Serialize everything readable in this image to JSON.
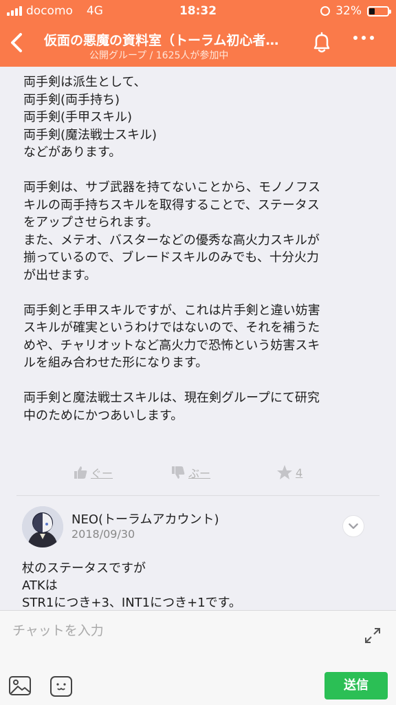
{
  "status_bar": {
    "carrier": "docomo",
    "network": "4G",
    "time": "18:32",
    "battery": "32%",
    "battery_level": 0.32
  },
  "header": {
    "title": "仮面の悪魔の資料室（トーラム初心者…",
    "subtitle": "公開グループ / 1625人が参加中",
    "background_color": "#fa7a4a"
  },
  "post": {
    "body": "両手剣は派生として、\n両手剣(両手持ち)\n両手剣(手甲スキル)\n両手剣(魔法戦士スキル)\nなどがあります。\n\n両手剣は、サブ武器を持てないことから、モノノフス\nキルの両手持ちスキルを取得することで、ステータス\nをアップさせられます。\nまた、メテオ、バスターなどの優秀な高火力スキルが\n揃っているので、ブレードスキルのみでも、十分火力\nが出せます。\n\n両手剣と手甲スキルですが、これは片手剣と違い妨害\nスキルが確実というわけではないので、それを補うた\nめや、チャリオットなど高火力で恐怖という妨害スキ\nルを組み合わせた形になります。\n\n両手剣と魔法戦士スキルは、現在剣グループにて研究\n中のためにかつあいします。",
    "actions": {
      "good_label": "ぐー",
      "bad_label": "ぶー",
      "star_count": "4"
    }
  },
  "comment": {
    "author": "NEO(トーラムアカウント)",
    "date": "2018/09/30",
    "body": "杖のステータスですが\nATKは\nSTR1につき+3、INT1につき+1です。"
  },
  "input_bar": {
    "placeholder": "チャットを入力",
    "send_label": "送信",
    "send_color": "#2bbf55"
  }
}
